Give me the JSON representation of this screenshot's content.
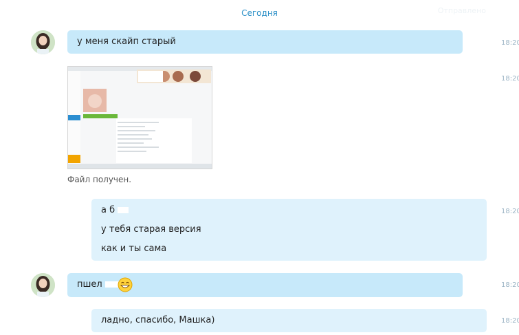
{
  "header": {
    "date_label": "Сегодня",
    "faded_label": "Отправлено"
  },
  "messages": [
    {
      "text": "у меня скайп старый",
      "time": "18:20"
    },
    {
      "file_caption": "Файл получен.",
      "time": "18:20"
    },
    {
      "lines": [
        "а б",
        "у тебя старая версия",
        "как и ты сама"
      ],
      "time": "18:20"
    },
    {
      "text": "пшел",
      "suffix": "..",
      "time": "18:20"
    },
    {
      "text": "ладно, спасибо, Машка)",
      "time": "18:20"
    }
  ],
  "colors": {
    "incoming_bubble": "#c7e9fa",
    "outgoing_bubble": "#dff2fc",
    "date_accent": "#2a8fc7",
    "time_text": "#9ab3c4"
  },
  "icons": [
    "avatar",
    "grin-emoji-icon",
    "screenshot-thumbnail"
  ]
}
